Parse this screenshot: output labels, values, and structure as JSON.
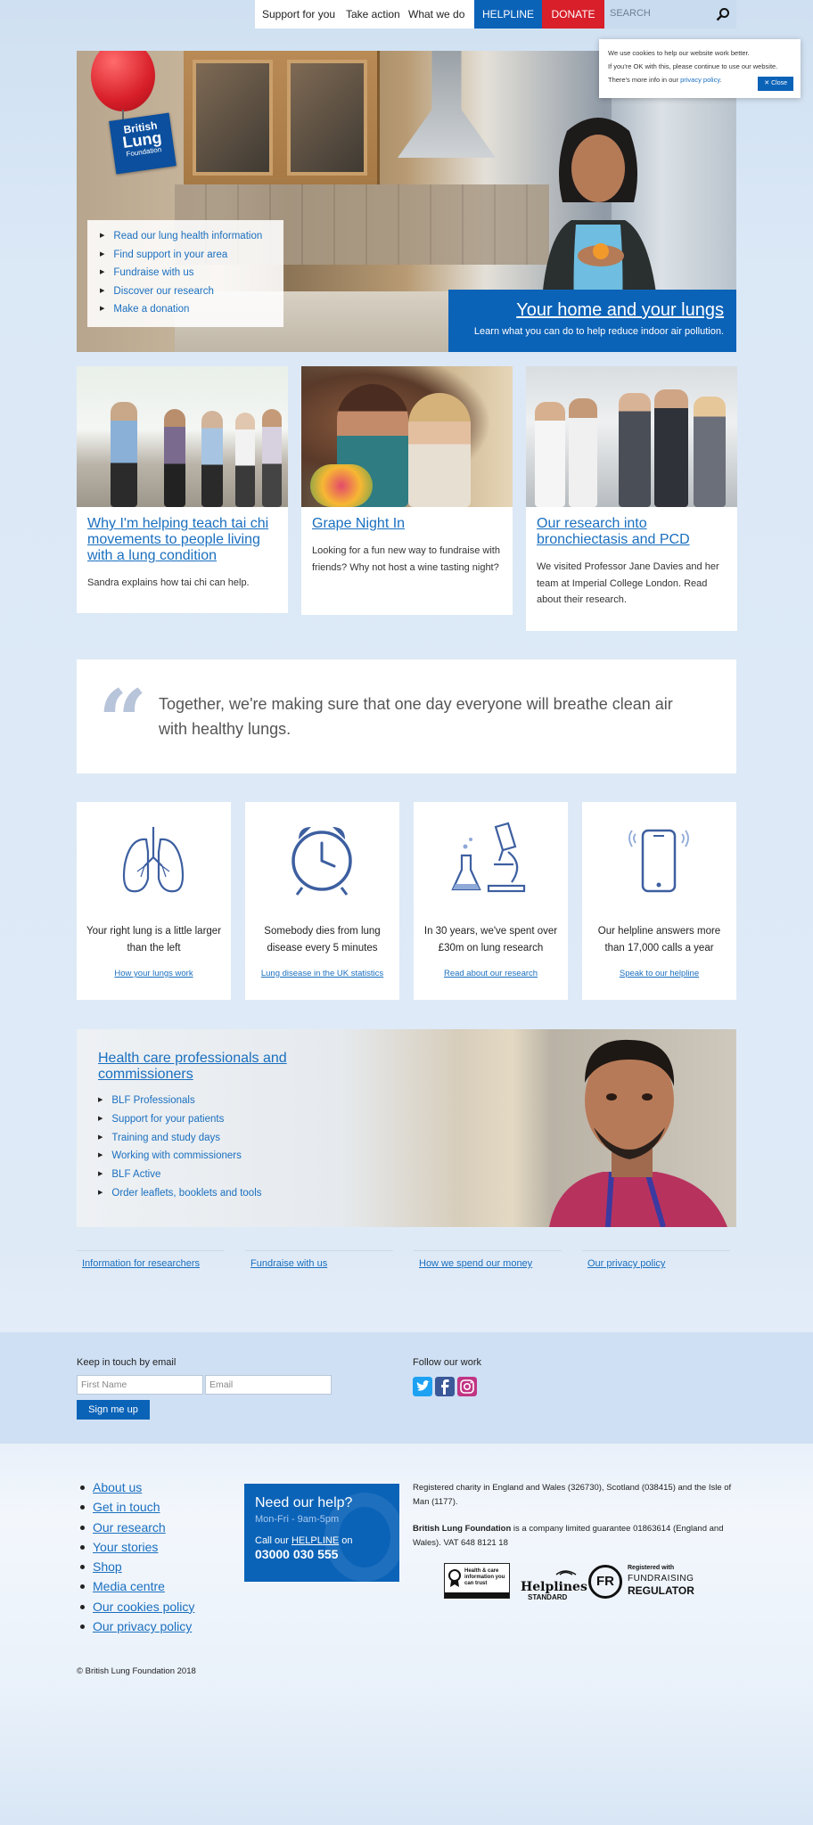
{
  "nav": {
    "items": [
      "Support for you",
      "Take action",
      "What we do"
    ],
    "helpline": "HELPLINE",
    "donate": "DONATE",
    "search_placeholder": "SEARCH"
  },
  "cookie": {
    "line1": "We use cookies to help our website work better.",
    "line2": "If you're OK with this, please continue to use our website.",
    "line3": "There's more info in our",
    "link": "privacy policy",
    "close": "Close"
  },
  "hero": {
    "logo": [
      "British",
      "Lung",
      "Foundation"
    ],
    "menu": [
      "Read our lung health information",
      "Find support in your area",
      "Fundraise with us",
      "Discover our research",
      "Make a donation"
    ],
    "title": "Your home and your lungs",
    "subtitle": "Learn what you can do to help reduce indoor air pollution."
  },
  "cards": [
    {
      "title": "Why I'm helping teach tai chi movements to people living with a lung condition",
      "desc": "Sandra explains how tai chi can help."
    },
    {
      "title": "Grape Night In",
      "desc": "Looking for a fun new way to fundraise with friends? Why not host a wine tasting night?"
    },
    {
      "title": "Our research into bronchiectasis and PCD",
      "desc": "We visited Professor Jane Davies and her team at Imperial College London. Read about their research."
    }
  ],
  "quote": "Together, we're making sure that one day everyone will breathe clean air with healthy lungs.",
  "facts": [
    {
      "icon": "lungs-icon",
      "text": "Your right lung is a little larger than the left",
      "link": "How your lungs work"
    },
    {
      "icon": "clock-icon",
      "text": "Somebody dies from lung disease every 5 minutes",
      "link": "Lung disease in the UK statistics"
    },
    {
      "icon": "microscope-icon",
      "text": "In 30 years, we've spent over £30m on lung research",
      "link": "Read about our research"
    },
    {
      "icon": "phone-icon",
      "text": "Our helpline answers more than 17,000 calls a year",
      "link": "Speak to our helpline"
    }
  ],
  "healthcare": {
    "title": "Health care professionals and commissioners",
    "items": [
      "BLF Professionals",
      "Support for your patients",
      "Training and study days",
      "Working with commissioners",
      "BLF Active",
      "Order leaflets, booklets and tools"
    ]
  },
  "link_row": [
    "Information for researchers",
    "Fundraise with us",
    "How we spend our money",
    "Our privacy policy"
  ],
  "newsletter": {
    "label": "Keep in touch by email",
    "first_name_placeholder": "First Name",
    "email_placeholder": "Email",
    "button": "Sign me up",
    "follow_label": "Follow our work"
  },
  "footer": {
    "links": [
      "About us",
      "Get in touch",
      "Our research",
      "Your stories",
      "Shop",
      "Media centre",
      "Our cookies policy",
      "Our privacy policy"
    ],
    "help_title": "Need our help?",
    "help_hours": "Mon-Fri - 9am-5pm",
    "help_call_pre": "Call our",
    "help_call_link": "HELPLINE",
    "help_call_post": "on",
    "help_number": "03000 030 555",
    "legal1": "Registered charity in England and Wales (326730), Scotland (038415) and the Isle of Man (1177).",
    "legal2_bold": "British Lung Foundation",
    "legal2": " is a company limited guarantee 01863614 (England and Wales). VAT 648 8121 18",
    "badge1": "Health & care information you can trust",
    "badge2_top": "Helplines",
    "badge2_bottom": "STANDARD",
    "badge3_top": "Registered with",
    "badge3_mid": "FUNDRAISING",
    "badge3_bottom": "REGULATOR",
    "badge3_logo": "FR",
    "copyright": "© British Lung Foundation 2018"
  },
  "colors": {
    "primary": "#0b63b8",
    "donate": "#d81f2a",
    "link": "#1a6fbf"
  }
}
